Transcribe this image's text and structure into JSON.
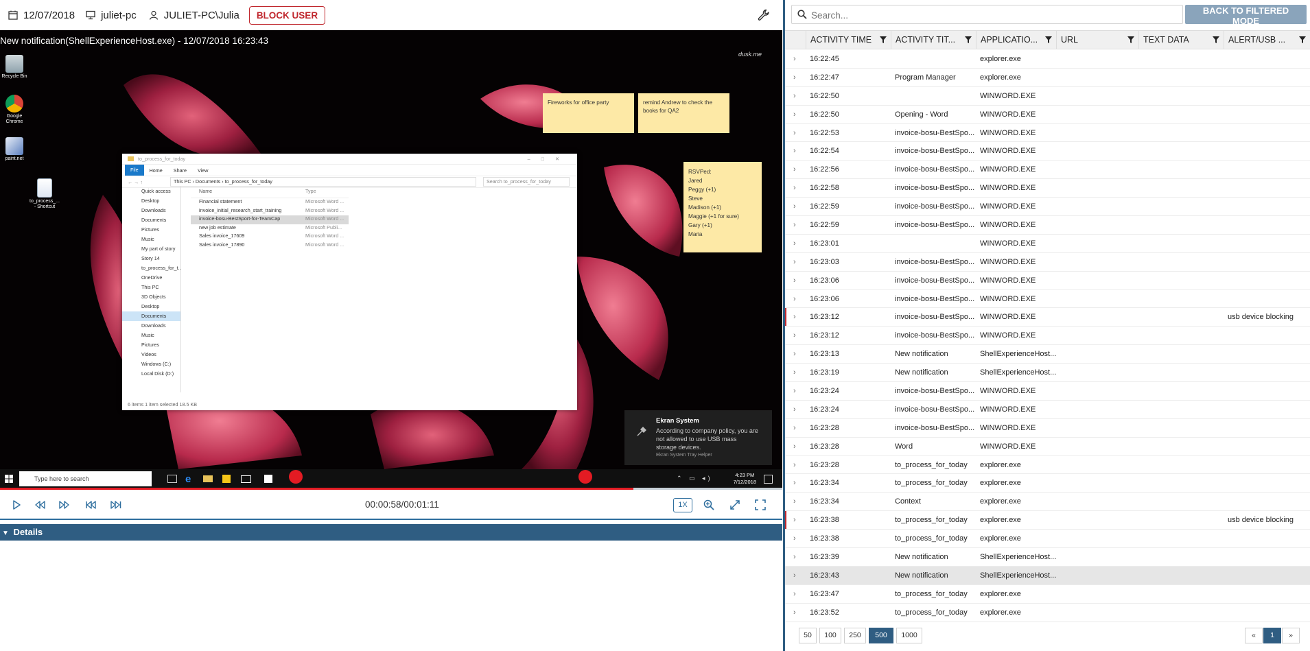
{
  "topbar": {
    "date": "12/07/2018",
    "computer": "juliet-pc",
    "user": "JULIET-PC\\Julia",
    "block_user_label": "BLOCK USER"
  },
  "screen": {
    "title": "New notification(ShellExperienceHost.exe) - 12/07/2018 16:23:43",
    "desktop_icons": [
      {
        "label": "Recycle Bin",
        "icon": "recycle-bin-icon"
      },
      {
        "label": "Google Chrome",
        "icon": "chrome-icon"
      },
      {
        "label": "paint.net",
        "icon": "paint-icon"
      },
      {
        "label": "to_process_... - Shortcut",
        "icon": "word-file-icon"
      }
    ],
    "sticky_notes": [
      {
        "text": "Fireworks for office party"
      },
      {
        "text": "remind Andrew to check the books for QA2"
      },
      {
        "lines": [
          "RSVPed:",
          "Jared",
          "Peggy (+1)",
          "Steve",
          "Madison (+1)",
          "Maggie (+1 for sure)",
          "Gary (+1)",
          "Maria"
        ]
      }
    ],
    "explorer": {
      "title": "to_process_for_today",
      "ribbon": [
        "File",
        "Home",
        "Share",
        "View"
      ],
      "path": [
        "This PC",
        "Documents",
        "to_process_for_today"
      ],
      "search_placeholder": "Search to_process_for_today",
      "nav": [
        "Quick access",
        "Desktop",
        "Downloads",
        "Documents",
        "Pictures",
        "Music",
        "My part of story",
        "Story 14",
        "to_process_for_t...",
        "OneDrive",
        "This PC",
        "3D Objects",
        "Desktop",
        "Documents",
        "Downloads",
        "Music",
        "Pictures",
        "Videos",
        "Windows (C:)",
        "Local Disk (D:)"
      ],
      "columns": [
        "Name",
        "Type"
      ],
      "files": [
        {
          "name": "Financial statement",
          "type": "Microsoft Word ..."
        },
        {
          "name": "invoice_initial_research_start_training",
          "type": "Microsoft Word ..."
        },
        {
          "name": "invoice-bosu-BestSport-for-TeamCap",
          "type": "Microsoft Word ..."
        },
        {
          "name": "new job estimate",
          "type": "Microsoft Publi..."
        },
        {
          "name": "Sales invoice_17609",
          "type": "Microsoft Word ..."
        },
        {
          "name": "Sales invoice_17890",
          "type": "Microsoft Word ..."
        }
      ],
      "status": "6 items     1 item selected  18.5 KB"
    },
    "toast": {
      "title": "Ekran System",
      "body": "According to company policy, you are not allowed to use USB mass storage devices.",
      "footer": "Ekran System Tray Helper"
    },
    "taskbar": {
      "search_placeholder": "Type here to search",
      "time": "4:23 PM",
      "date": "7/12/2018"
    },
    "watermark": "dusk.me"
  },
  "player": {
    "timecode": "00:00:58/00:01:11",
    "speed": "1X",
    "progress_fraction": 0.81
  },
  "details": {
    "label": "Details"
  },
  "search": {
    "placeholder": "Search..."
  },
  "back_button_label": "BACK TO FILTERED MODE",
  "grid": {
    "columns": [
      "ACTIVITY TIME",
      "ACTIVITY TIT...",
      "APPLICATIO...",
      "URL",
      "TEXT DATA",
      "ALERT/USB ..."
    ],
    "rows": [
      {
        "time": "16:22:45",
        "title": "",
        "app": "explorer.exe",
        "url": "",
        "text": "",
        "alert": ""
      },
      {
        "time": "16:22:47",
        "title": "Program Manager",
        "app": "explorer.exe",
        "url": "",
        "text": "",
        "alert": ""
      },
      {
        "time": "16:22:50",
        "title": "",
        "app": "WINWORD.EXE",
        "url": "",
        "text": "",
        "alert": ""
      },
      {
        "time": "16:22:50",
        "title": "Opening - Word",
        "app": "WINWORD.EXE",
        "url": "",
        "text": "",
        "alert": ""
      },
      {
        "time": "16:22:53",
        "title": "invoice-bosu-BestSpo...",
        "app": "WINWORD.EXE",
        "url": "",
        "text": "",
        "alert": ""
      },
      {
        "time": "16:22:54",
        "title": "invoice-bosu-BestSpo...",
        "app": "WINWORD.EXE",
        "url": "",
        "text": "",
        "alert": ""
      },
      {
        "time": "16:22:56",
        "title": "invoice-bosu-BestSpo...",
        "app": "WINWORD.EXE",
        "url": "",
        "text": "",
        "alert": ""
      },
      {
        "time": "16:22:58",
        "title": "invoice-bosu-BestSpo...",
        "app": "WINWORD.EXE",
        "url": "",
        "text": "",
        "alert": ""
      },
      {
        "time": "16:22:59",
        "title": "invoice-bosu-BestSpo...",
        "app": "WINWORD.EXE",
        "url": "",
        "text": "",
        "alert": ""
      },
      {
        "time": "16:22:59",
        "title": "invoice-bosu-BestSpo...",
        "app": "WINWORD.EXE",
        "url": "",
        "text": "",
        "alert": ""
      },
      {
        "time": "16:23:01",
        "title": "",
        "app": "WINWORD.EXE",
        "url": "",
        "text": "",
        "alert": ""
      },
      {
        "time": "16:23:03",
        "title": "invoice-bosu-BestSpo...",
        "app": "WINWORD.EXE",
        "url": "",
        "text": "",
        "alert": ""
      },
      {
        "time": "16:23:06",
        "title": "invoice-bosu-BestSpo...",
        "app": "WINWORD.EXE",
        "url": "",
        "text": "",
        "alert": ""
      },
      {
        "time": "16:23:06",
        "title": "invoice-bosu-BestSpo...",
        "app": "WINWORD.EXE",
        "url": "",
        "text": "",
        "alert": ""
      },
      {
        "time": "16:23:12",
        "title": "invoice-bosu-BestSpo...",
        "app": "WINWORD.EXE",
        "url": "",
        "text": "",
        "alert": "usb device blocking"
      },
      {
        "time": "16:23:12",
        "title": "invoice-bosu-BestSpo...",
        "app": "WINWORD.EXE",
        "url": "",
        "text": "",
        "alert": ""
      },
      {
        "time": "16:23:13",
        "title": "New notification",
        "app": "ShellExperienceHost....",
        "url": "",
        "text": "",
        "alert": ""
      },
      {
        "time": "16:23:19",
        "title": "New notification",
        "app": "ShellExperienceHost....",
        "url": "",
        "text": "",
        "alert": ""
      },
      {
        "time": "16:23:24",
        "title": "invoice-bosu-BestSpo...",
        "app": "WINWORD.EXE",
        "url": "",
        "text": "",
        "alert": ""
      },
      {
        "time": "16:23:24",
        "title": "invoice-bosu-BestSpo...",
        "app": "WINWORD.EXE",
        "url": "",
        "text": "",
        "alert": ""
      },
      {
        "time": "16:23:28",
        "title": "invoice-bosu-BestSpo...",
        "app": "WINWORD.EXE",
        "url": "",
        "text": "",
        "alert": ""
      },
      {
        "time": "16:23:28",
        "title": "Word",
        "app": "WINWORD.EXE",
        "url": "",
        "text": "",
        "alert": ""
      },
      {
        "time": "16:23:28",
        "title": "to_process_for_today",
        "app": "explorer.exe",
        "url": "",
        "text": "",
        "alert": ""
      },
      {
        "time": "16:23:34",
        "title": "to_process_for_today",
        "app": "explorer.exe",
        "url": "",
        "text": "",
        "alert": ""
      },
      {
        "time": "16:23:34",
        "title": "Context",
        "app": "explorer.exe",
        "url": "",
        "text": "",
        "alert": ""
      },
      {
        "time": "16:23:38",
        "title": "to_process_for_today",
        "app": "explorer.exe",
        "url": "",
        "text": "",
        "alert": "usb device blocking"
      },
      {
        "time": "16:23:38",
        "title": "to_process_for_today",
        "app": "explorer.exe",
        "url": "",
        "text": "",
        "alert": ""
      },
      {
        "time": "16:23:39",
        "title": "New notification",
        "app": "ShellExperienceHost....",
        "url": "",
        "text": "",
        "alert": ""
      },
      {
        "time": "16:23:43",
        "title": "New notification",
        "app": "ShellExperienceHost....",
        "url": "",
        "text": "",
        "alert": "",
        "selected": true
      },
      {
        "time": "16:23:47",
        "title": "to_process_for_today",
        "app": "explorer.exe",
        "url": "",
        "text": "",
        "alert": ""
      },
      {
        "time": "16:23:52",
        "title": "to_process_for_today",
        "app": "explorer.exe",
        "url": "",
        "text": "",
        "alert": ""
      }
    ]
  },
  "pager": {
    "page_sizes": [
      "50",
      "100",
      "250",
      "500",
      "1000"
    ],
    "active_size": "500",
    "prev": "«",
    "page": "1",
    "next": "»"
  },
  "colors": {
    "accent": "#2f5d82",
    "alert": "#c0272d",
    "back_button": "#8aa4bb",
    "progress": "#e31b23",
    "sticky": "#fde9a6"
  }
}
